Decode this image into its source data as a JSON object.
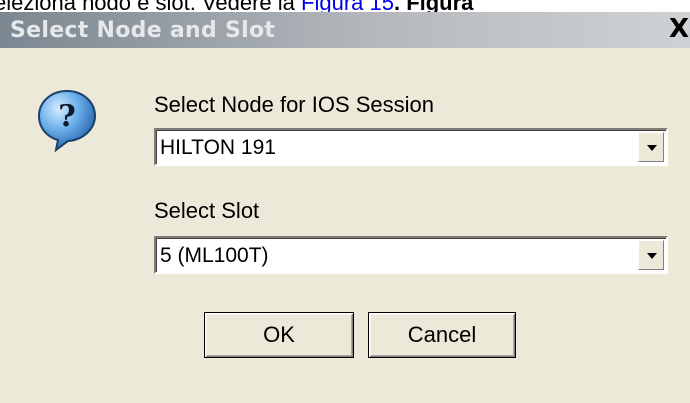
{
  "document_fragment": {
    "text_before": "eleziona nodo e slot. Vedere la ",
    "link": "Figura 15",
    "text_after": ". Figura"
  },
  "dialog": {
    "title": "Select Node and Slot",
    "close_label": "X",
    "icon": "question-icon",
    "node_label": "Select Node for IOS Session",
    "node_value": "HILTON 191",
    "slot_label": "Select Slot",
    "slot_value": "5 (ML100T)",
    "ok_label": "OK",
    "cancel_label": "Cancel"
  },
  "colors": {
    "dialog_background": "#ece9d8",
    "titlebar_start": "#7b8791",
    "titlebar_end": "#cfd2d4",
    "icon_fill": "#3f8fd6"
  }
}
